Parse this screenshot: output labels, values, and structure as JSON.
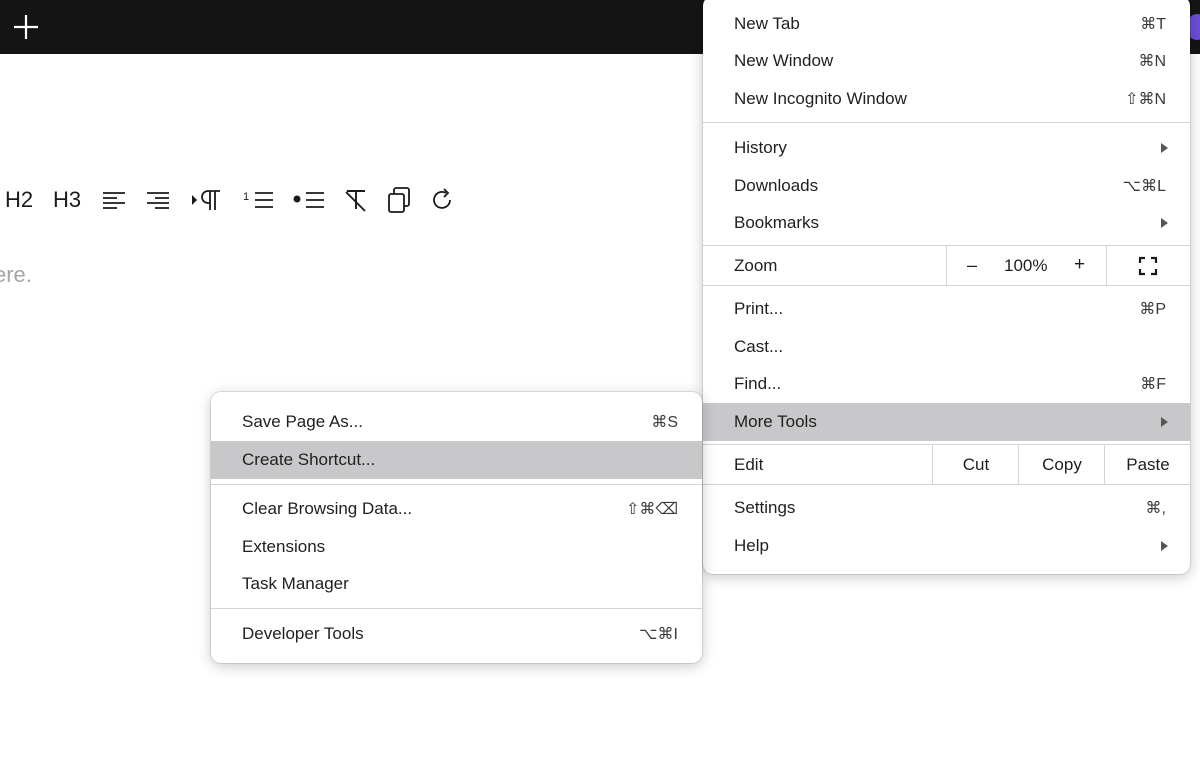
{
  "editor": {
    "toolbar": {
      "h2": "H2",
      "h3": "H3"
    },
    "placeholder_fragment": "ere."
  },
  "main_menu": {
    "new_tab": {
      "label": "New Tab",
      "shortcut": "⌘T"
    },
    "new_window": {
      "label": "New Window",
      "shortcut": "⌘N"
    },
    "new_incognito": {
      "label": "New Incognito Window",
      "shortcut": "⇧⌘N"
    },
    "history": {
      "label": "History"
    },
    "downloads": {
      "label": "Downloads",
      "shortcut": "⌥⌘L"
    },
    "bookmarks": {
      "label": "Bookmarks"
    },
    "zoom": {
      "label": "Zoom",
      "minus": "–",
      "value": "100%",
      "plus": "+"
    },
    "print": {
      "label": "Print...",
      "shortcut": "⌘P"
    },
    "cast": {
      "label": "Cast..."
    },
    "find": {
      "label": "Find...",
      "shortcut": "⌘F"
    },
    "more_tools": {
      "label": "More Tools"
    },
    "edit": {
      "label": "Edit",
      "cut": "Cut",
      "copy": "Copy",
      "paste": "Paste"
    },
    "settings": {
      "label": "Settings",
      "shortcut": "⌘,"
    },
    "help": {
      "label": "Help"
    }
  },
  "more_tools_menu": {
    "save_page": {
      "label": "Save Page As...",
      "shortcut": "⌘S"
    },
    "create_shortcut": {
      "label": "Create Shortcut..."
    },
    "clear_browsing": {
      "label": "Clear Browsing Data...",
      "shortcut": "⇧⌘⌫"
    },
    "extensions": {
      "label": "Extensions"
    },
    "task_manager": {
      "label": "Task Manager"
    },
    "developer_tools": {
      "label": "Developer Tools",
      "shortcut": "⌥⌘I"
    }
  },
  "colors": {
    "topbar": "#141414",
    "highlight": "#c8c8ca",
    "avatar": "#6a4fd6"
  }
}
